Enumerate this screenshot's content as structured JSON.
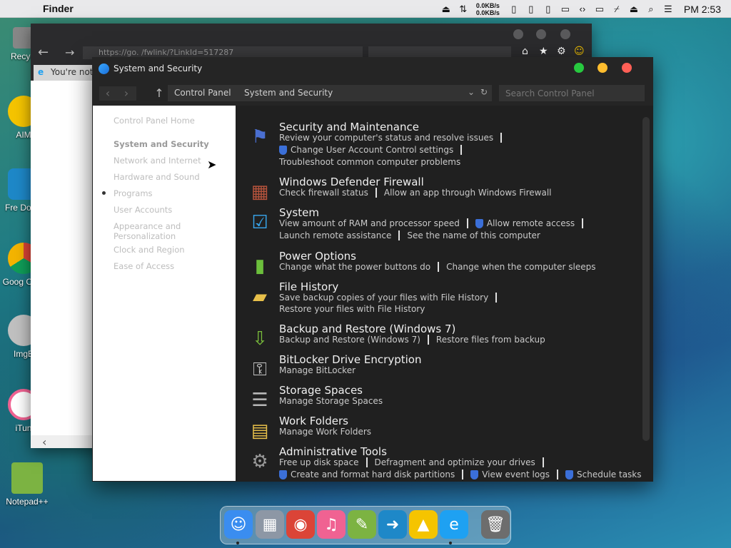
{
  "menubar": {
    "app_name": "Finder",
    "net_up": "0.0KB/s",
    "net_down": "0.0KB/s",
    "clock": "PM 2:53"
  },
  "desktop_icons": [
    {
      "label": "Recycl",
      "color": "#888888"
    },
    {
      "label": "AIM",
      "color": "#f5c400"
    },
    {
      "label": "Fre Down",
      "color": "#1e88c8"
    },
    {
      "label": "Goog Chro",
      "color": "#db4437"
    },
    {
      "label": "ImgB",
      "color": "#c0c0c0"
    },
    {
      "label": "iTun",
      "color": "#f06292"
    },
    {
      "label": "Notepad++",
      "color": "#7cb342"
    }
  ],
  "browser": {
    "url": "https://go.              /fwlink/?LinkId=517287",
    "tab_label": "You're not"
  },
  "window": {
    "title": "System and Security",
    "breadcrumb_1": "Control Panel",
    "breadcrumb_2": "System and Security",
    "search_placeholder": "Search Control Panel"
  },
  "left_pane": {
    "home": "Control Panel Home",
    "items": [
      "System and Security",
      "Network and Internet",
      "Hardware and Sound",
      "Programs",
      "User Accounts",
      "Appearance and Personalization",
      "Clock and Region",
      "Ease of Access"
    ]
  },
  "categories": [
    {
      "title": "Security and Maintenance",
      "links": [
        "Review your computer's status and resolve issues",
        "Change User Account Control settings",
        "Troubleshoot common computer problems"
      ]
    },
    {
      "title": "Windows Defender Firewall",
      "links": [
        "Check firewall status",
        "Allow an app through Windows Firewall"
      ]
    },
    {
      "title": "System",
      "links": [
        "View amount of RAM and processor speed",
        "Allow remote access",
        "Launch remote assistance",
        "See the name of this computer"
      ]
    },
    {
      "title": "Power Options",
      "links": [
        "Change what the power buttons do",
        "Change when the computer sleeps"
      ]
    },
    {
      "title": "File History",
      "links": [
        "Save backup copies of your files with File History",
        "Restore your files with File History"
      ]
    },
    {
      "title": "Backup and Restore (Windows 7)",
      "links": [
        "Backup and Restore (Windows 7)",
        "Restore files from backup"
      ]
    },
    {
      "title": "BitLocker Drive Encryption",
      "links": [
        "Manage BitLocker"
      ]
    },
    {
      "title": "Storage Spaces",
      "links": [
        "Manage Storage Spaces"
      ]
    },
    {
      "title": "Work Folders",
      "links": [
        "Manage Work Folders"
      ]
    },
    {
      "title": "Administrative Tools",
      "links": [
        "Free up disk space",
        "Defragment and optimize your drives",
        "Create and format hard disk partitions",
        "View event logs",
        "Schedule tasks"
      ]
    }
  ],
  "colors": {
    "traffic_green": "#27c93f",
    "traffic_yellow": "#ffbd2e",
    "traffic_red": "#ff5f56",
    "shield": "#3b6fd8"
  },
  "dock": [
    {
      "name": "finder",
      "color": "#3a8df0",
      "glyph": "☺"
    },
    {
      "name": "launchpad",
      "color": "#8d97a5",
      "glyph": "▦"
    },
    {
      "name": "chrome",
      "color": "#db4437",
      "glyph": "◉"
    },
    {
      "name": "itunes",
      "color": "#f06292",
      "glyph": "♫"
    },
    {
      "name": "notepad-plus-plus",
      "color": "#7cb342",
      "glyph": "✎"
    },
    {
      "name": "free-download-manager",
      "color": "#1e88c8",
      "glyph": "➜"
    },
    {
      "name": "aim",
      "color": "#f5c400",
      "glyph": "▲"
    },
    {
      "name": "internet-explorer",
      "color": "#1ea1f2",
      "glyph": "e"
    },
    {
      "name": "trash",
      "color": "#6d6d6d",
      "glyph": "🗑"
    }
  ]
}
